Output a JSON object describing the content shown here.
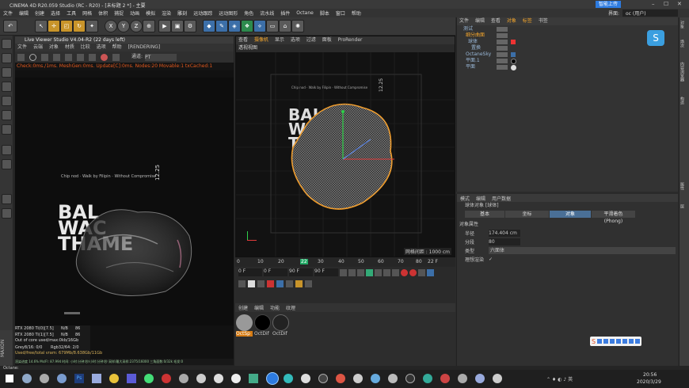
{
  "window": {
    "title": "CINEMA 4D R20.059 Studio (RC - R20) - [未标题 2 *] - 主要",
    "badge": "智能上传",
    "layout_label": "界面:",
    "layout_value": "oc (用户)"
  },
  "menu": [
    "文件",
    "编辑",
    "创建",
    "选择",
    "工具",
    "网格",
    "体积",
    "捕捉",
    "动画",
    "模拟",
    "渲染",
    "雕刻",
    "运动跟踪",
    "运动图形",
    "角色",
    "流水线",
    "插件",
    "Octane",
    "脚本",
    "窗口",
    "帮助"
  ],
  "toolbar": {
    "x": "X",
    "y": "Y",
    "z": "Z"
  },
  "live_viewer": {
    "title": "Live Viewer Studio V4.04-R2 (22 days left)",
    "menu": [
      "文件",
      "云端",
      "对象",
      "材质",
      "比较",
      "选项",
      "帮助",
      "[RENDERING]"
    ],
    "channel_label": "通道:",
    "channel_value": "PT",
    "status": "Check:0ms./1ms. MeshGen:0ms. Update[C]:0ms. Nodes:20 Movable:1 txCached:1",
    "poster_line": "Chip nod · Walk by Filipin · Without Compromise",
    "poster_num": "12.25",
    "poster_text": [
      "BAL",
      "WAC",
      "THAME"
    ],
    "gpu": [
      [
        "RTX 2080 Ti(0)[7.5]",
        "N/B",
        "86"
      ],
      [
        "RTX 2080 Ti(1)[7.5]",
        "N/B",
        "86"
      ],
      [
        "Out of core used/max:0kb/16Gb",
        "",
        ""
      ],
      [
        "Grey8/16: 0/0",
        "Rgb32/64: 2/0",
        ""
      ],
      [
        "Used/free/total vram: 679Mb/8.638Gb/11Gb",
        "",
        ""
      ]
    ],
    "bottom": "渲染进度 14.6%  Ms/Fl: 87.994  时间: 小时:分钟:秒/小时:分钟:秒  采样/最大采样:2375/16000  三角面数:0/32k  毛发:0"
  },
  "viewport": {
    "tabs": [
      "查看",
      "摄像机",
      "显示",
      "选项",
      "过滤",
      "面板",
      "ProRender"
    ],
    "label": "透视视图",
    "grid_info": "网格间距 : 1000 cm",
    "poster_line": "Chip nod · Walk by Filipin · Without Compromise",
    "poster_num": "12.25",
    "poster_text": [
      "BAL",
      "WA",
      "THAM"
    ]
  },
  "timeline": {
    "ticks": [
      "0",
      "10",
      "20",
      "30",
      "40",
      "50",
      "60",
      "70",
      "80",
      "90"
    ],
    "current": "22",
    "frame_end": "22 F",
    "start": "0 F",
    "start2": "0 F",
    "end": "90 F",
    "end2": "90 F"
  },
  "materials": {
    "tabs": [
      "创建",
      "编辑",
      "功能",
      "纹理"
    ],
    "items": [
      "OctSp",
      "OctDif",
      "OctDif"
    ]
  },
  "objects": {
    "menu": [
      "文件",
      "编辑",
      "查看",
      "对象",
      "标签",
      "书签"
    ],
    "items": [
      {
        "name": "测试",
        "color": "#9ab8d8"
      },
      {
        "name": "细分曲面",
        "color": "#f3a52b"
      },
      {
        "name": "球体",
        "color": "#9ab8d8"
      },
      {
        "name": "置换",
        "color": "#9ab8d8"
      },
      {
        "name": "OctaneSky",
        "color": "#9ab8d8"
      },
      {
        "name": "平面.1",
        "color": "#9ab8d8"
      },
      {
        "name": "平面",
        "color": "#9ab8d8"
      }
    ]
  },
  "attributes": {
    "menu": [
      "模式",
      "编辑",
      "用户数据"
    ],
    "object_title": "球体对象 [球体]",
    "tabs": [
      "基本",
      "坐标",
      "对象",
      "平滑着色(Phong)"
    ],
    "section": "对象属性",
    "fields": [
      {
        "label": "半径",
        "value": "174.404 cm"
      },
      {
        "label": "分段",
        "value": "80"
      },
      {
        "label": "类型",
        "value": "六面体"
      },
      {
        "label": "理想渲染",
        "value": "✓"
      }
    ]
  },
  "side_tabs": [
    "对象",
    "场次",
    "内容浏览器",
    "构造",
    "属性",
    "层"
  ],
  "bottom_status": "Octane:",
  "taskbar": {
    "time": "20:56",
    "date": "2020/3/29"
  }
}
